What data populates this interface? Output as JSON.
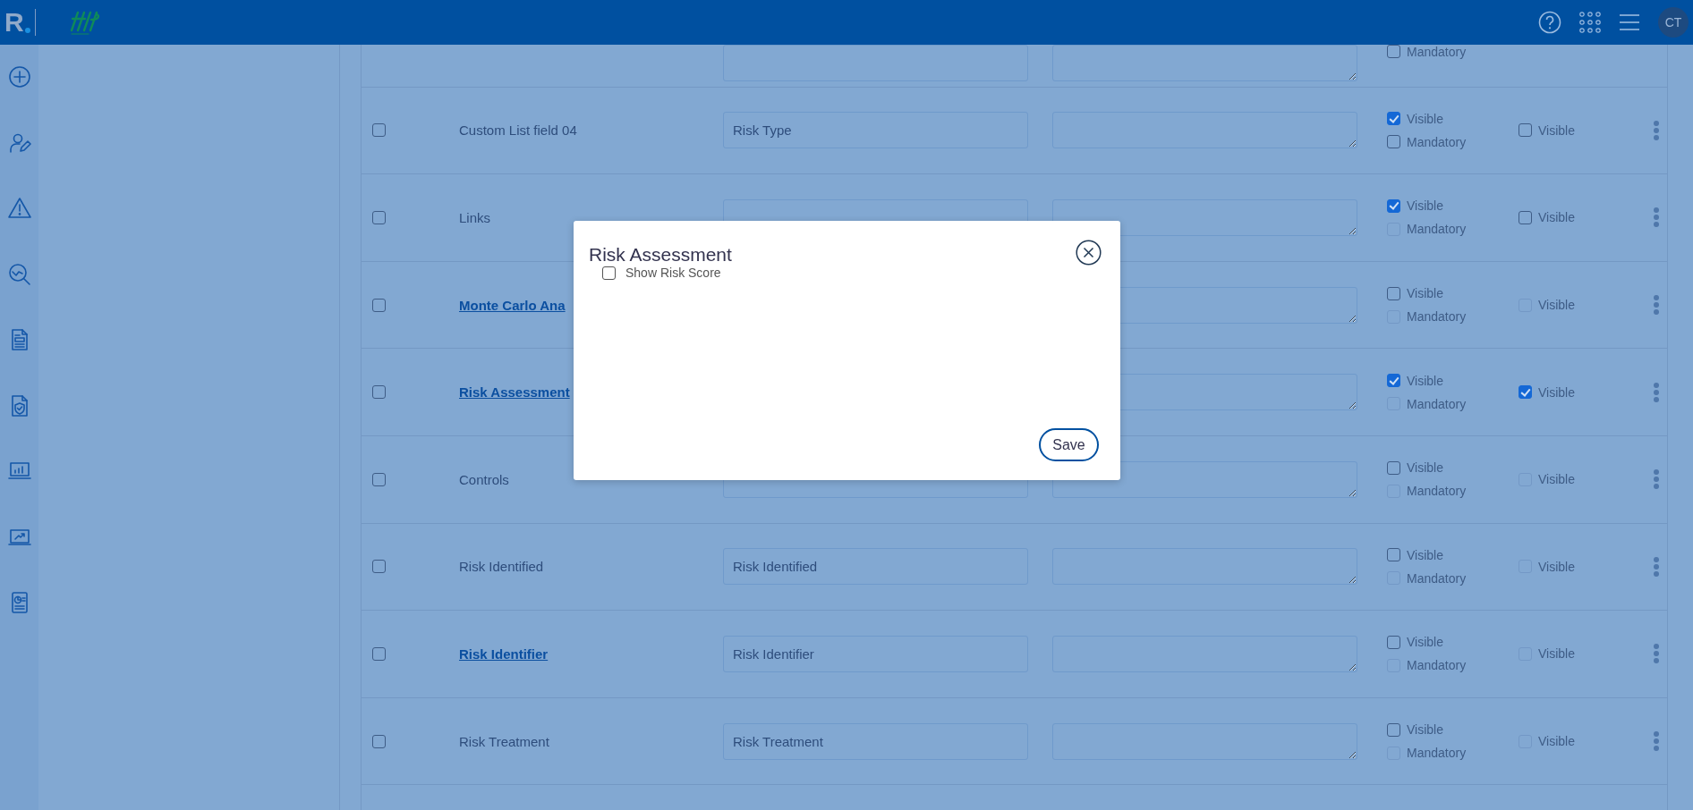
{
  "top_bar": {
    "brand": "R",
    "avatar": "CT"
  },
  "table": {
    "rows": [
      {
        "kind": "cut",
        "checks": [
          {
            "kind": "mandatory",
            "label": "Mandatory",
            "checked": false,
            "disabled": false
          }
        ]
      },
      {
        "name": "Custom List field 04",
        "kind": "plain",
        "selected": false,
        "field": "Risk Type",
        "checks": [
          {
            "kind": "visible",
            "label": "Visible",
            "checked": true,
            "disabled": false
          },
          {
            "kind": "mandatory",
            "label": "Mandatory",
            "checked": false,
            "disabled": false
          }
        ],
        "display": {
          "label": "Visible",
          "checked": false,
          "disabled": false
        }
      },
      {
        "name": "Links",
        "kind": "plain",
        "selected": false,
        "field_box": true,
        "checks": [
          {
            "kind": "visible",
            "label": "Visible",
            "checked": true,
            "disabled": false
          },
          {
            "kind": "mandatory",
            "label": "Mandatory",
            "checked": false,
            "disabled": true
          }
        ],
        "display": {
          "label": "Visible",
          "checked": false,
          "disabled": false
        }
      },
      {
        "name": "Monte Carlo Ana",
        "kind": "link",
        "selected": false,
        "checks": [
          {
            "kind": "visible",
            "label": "Visible",
            "checked": false,
            "disabled": false
          },
          {
            "kind": "mandatory",
            "label": "Mandatory",
            "checked": false,
            "disabled": true
          }
        ],
        "display": {
          "label": "Visible",
          "checked": false,
          "disabled": true
        }
      },
      {
        "name": "Risk Assessment",
        "kind": "link",
        "selected": false,
        "checks": [
          {
            "kind": "visible",
            "label": "Visible",
            "checked": true,
            "disabled": false
          },
          {
            "kind": "mandatory",
            "label": "Mandatory",
            "checked": false,
            "disabled": true
          }
        ],
        "display": {
          "label": "Visible",
          "checked": true,
          "disabled": false
        }
      },
      {
        "name": "Controls",
        "kind": "plain",
        "selected": false,
        "field_box": true,
        "checks": [
          {
            "kind": "visible",
            "label": "Visible",
            "checked": false,
            "disabled": false
          },
          {
            "kind": "mandatory",
            "label": "Mandatory",
            "checked": false,
            "disabled": true
          }
        ],
        "display": {
          "label": "Visible",
          "checked": false,
          "disabled": true
        }
      },
      {
        "name": "Risk Identified",
        "kind": "plain",
        "selected": false,
        "field": "Risk Identified",
        "checks": [
          {
            "kind": "visible",
            "label": "Visible",
            "checked": false,
            "disabled": false
          },
          {
            "kind": "mandatory",
            "label": "Mandatory",
            "checked": false,
            "disabled": true
          }
        ],
        "display": {
          "label": "Visible",
          "checked": false,
          "disabled": true
        }
      },
      {
        "name": "Risk Identifier",
        "kind": "link",
        "selected": false,
        "field": "Risk Identifier",
        "checks": [
          {
            "kind": "visible",
            "label": "Visible",
            "checked": false,
            "disabled": false
          },
          {
            "kind": "mandatory",
            "label": "Mandatory",
            "checked": false,
            "disabled": true
          }
        ],
        "display": {
          "label": "Visible",
          "checked": false,
          "disabled": true
        }
      },
      {
        "name": "Risk Treatment",
        "kind": "plain",
        "selected": false,
        "field": "Risk Treatment",
        "checks": [
          {
            "kind": "visible",
            "label": "Visible",
            "checked": false,
            "disabled": false
          },
          {
            "kind": "mandatory",
            "label": "Mandatory",
            "checked": false,
            "disabled": true
          }
        ],
        "display": {
          "label": "Visible",
          "checked": false,
          "disabled": true
        }
      }
    ]
  },
  "dialog": {
    "title": "Risk Assessment",
    "options": [
      {
        "label": "Show Risk Score",
        "checked": false
      }
    ],
    "save": "Save"
  }
}
